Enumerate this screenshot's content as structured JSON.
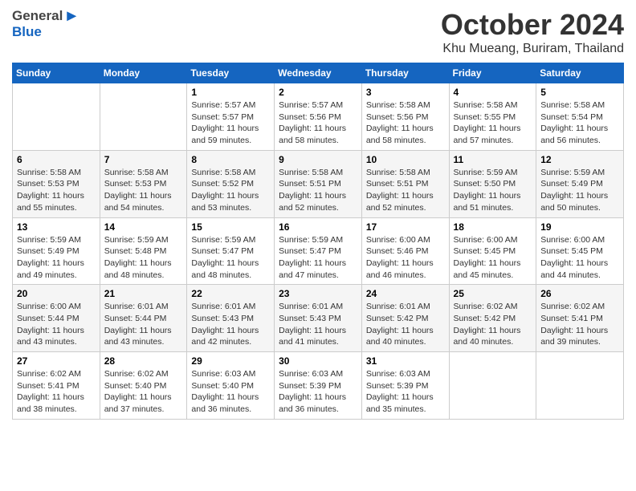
{
  "header": {
    "logo_general": "General",
    "logo_blue": "Blue",
    "month": "October 2024",
    "location": "Khu Mueang, Buriram, Thailand"
  },
  "weekdays": [
    "Sunday",
    "Monday",
    "Tuesday",
    "Wednesday",
    "Thursday",
    "Friday",
    "Saturday"
  ],
  "weeks": [
    [
      {
        "day": "",
        "info": ""
      },
      {
        "day": "",
        "info": ""
      },
      {
        "day": "1",
        "info": "Sunrise: 5:57 AM\nSunset: 5:57 PM\nDaylight: 11 hours\nand 59 minutes."
      },
      {
        "day": "2",
        "info": "Sunrise: 5:57 AM\nSunset: 5:56 PM\nDaylight: 11 hours\nand 58 minutes."
      },
      {
        "day": "3",
        "info": "Sunrise: 5:58 AM\nSunset: 5:56 PM\nDaylight: 11 hours\nand 58 minutes."
      },
      {
        "day": "4",
        "info": "Sunrise: 5:58 AM\nSunset: 5:55 PM\nDaylight: 11 hours\nand 57 minutes."
      },
      {
        "day": "5",
        "info": "Sunrise: 5:58 AM\nSunset: 5:54 PM\nDaylight: 11 hours\nand 56 minutes."
      }
    ],
    [
      {
        "day": "6",
        "info": "Sunrise: 5:58 AM\nSunset: 5:53 PM\nDaylight: 11 hours\nand 55 minutes."
      },
      {
        "day": "7",
        "info": "Sunrise: 5:58 AM\nSunset: 5:53 PM\nDaylight: 11 hours\nand 54 minutes."
      },
      {
        "day": "8",
        "info": "Sunrise: 5:58 AM\nSunset: 5:52 PM\nDaylight: 11 hours\nand 53 minutes."
      },
      {
        "day": "9",
        "info": "Sunrise: 5:58 AM\nSunset: 5:51 PM\nDaylight: 11 hours\nand 52 minutes."
      },
      {
        "day": "10",
        "info": "Sunrise: 5:58 AM\nSunset: 5:51 PM\nDaylight: 11 hours\nand 52 minutes."
      },
      {
        "day": "11",
        "info": "Sunrise: 5:59 AM\nSunset: 5:50 PM\nDaylight: 11 hours\nand 51 minutes."
      },
      {
        "day": "12",
        "info": "Sunrise: 5:59 AM\nSunset: 5:49 PM\nDaylight: 11 hours\nand 50 minutes."
      }
    ],
    [
      {
        "day": "13",
        "info": "Sunrise: 5:59 AM\nSunset: 5:49 PM\nDaylight: 11 hours\nand 49 minutes."
      },
      {
        "day": "14",
        "info": "Sunrise: 5:59 AM\nSunset: 5:48 PM\nDaylight: 11 hours\nand 48 minutes."
      },
      {
        "day": "15",
        "info": "Sunrise: 5:59 AM\nSunset: 5:47 PM\nDaylight: 11 hours\nand 48 minutes."
      },
      {
        "day": "16",
        "info": "Sunrise: 5:59 AM\nSunset: 5:47 PM\nDaylight: 11 hours\nand 47 minutes."
      },
      {
        "day": "17",
        "info": "Sunrise: 6:00 AM\nSunset: 5:46 PM\nDaylight: 11 hours\nand 46 minutes."
      },
      {
        "day": "18",
        "info": "Sunrise: 6:00 AM\nSunset: 5:45 PM\nDaylight: 11 hours\nand 45 minutes."
      },
      {
        "day": "19",
        "info": "Sunrise: 6:00 AM\nSunset: 5:45 PM\nDaylight: 11 hours\nand 44 minutes."
      }
    ],
    [
      {
        "day": "20",
        "info": "Sunrise: 6:00 AM\nSunset: 5:44 PM\nDaylight: 11 hours\nand 43 minutes."
      },
      {
        "day": "21",
        "info": "Sunrise: 6:01 AM\nSunset: 5:44 PM\nDaylight: 11 hours\nand 43 minutes."
      },
      {
        "day": "22",
        "info": "Sunrise: 6:01 AM\nSunset: 5:43 PM\nDaylight: 11 hours\nand 42 minutes."
      },
      {
        "day": "23",
        "info": "Sunrise: 6:01 AM\nSunset: 5:43 PM\nDaylight: 11 hours\nand 41 minutes."
      },
      {
        "day": "24",
        "info": "Sunrise: 6:01 AM\nSunset: 5:42 PM\nDaylight: 11 hours\nand 40 minutes."
      },
      {
        "day": "25",
        "info": "Sunrise: 6:02 AM\nSunset: 5:42 PM\nDaylight: 11 hours\nand 40 minutes."
      },
      {
        "day": "26",
        "info": "Sunrise: 6:02 AM\nSunset: 5:41 PM\nDaylight: 11 hours\nand 39 minutes."
      }
    ],
    [
      {
        "day": "27",
        "info": "Sunrise: 6:02 AM\nSunset: 5:41 PM\nDaylight: 11 hours\nand 38 minutes."
      },
      {
        "day": "28",
        "info": "Sunrise: 6:02 AM\nSunset: 5:40 PM\nDaylight: 11 hours\nand 37 minutes."
      },
      {
        "day": "29",
        "info": "Sunrise: 6:03 AM\nSunset: 5:40 PM\nDaylight: 11 hours\nand 36 minutes."
      },
      {
        "day": "30",
        "info": "Sunrise: 6:03 AM\nSunset: 5:39 PM\nDaylight: 11 hours\nand 36 minutes."
      },
      {
        "day": "31",
        "info": "Sunrise: 6:03 AM\nSunset: 5:39 PM\nDaylight: 11 hours\nand 35 minutes."
      },
      {
        "day": "",
        "info": ""
      },
      {
        "day": "",
        "info": ""
      }
    ]
  ]
}
